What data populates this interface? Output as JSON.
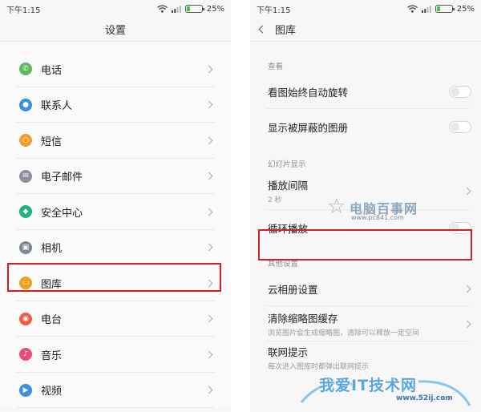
{
  "left": {
    "status": {
      "time": "下午1:15",
      "battery": "25%",
      "battery_level": 0.25
    },
    "title": "设置",
    "items": [
      {
        "label": "电话",
        "icon": "phone-icon",
        "color": "#5cb85c",
        "glyph": "✆"
      },
      {
        "label": "联系人",
        "icon": "contacts-icon",
        "color": "#3a8ee6",
        "glyph": "●"
      },
      {
        "label": "短信",
        "icon": "message-icon",
        "color": "#f39c27",
        "glyph": "○"
      },
      {
        "label": "电子邮件",
        "icon": "mail-icon",
        "color": "#8a9099",
        "glyph": "✉"
      },
      {
        "label": "安全中心",
        "icon": "shield-icon",
        "color": "#23b07a",
        "glyph": "◆"
      },
      {
        "label": "相机",
        "icon": "camera-icon",
        "color": "#7f8891",
        "glyph": "▣"
      },
      {
        "label": "图库",
        "icon": "gallery-icon",
        "color": "#f0a020",
        "glyph": "▭"
      },
      {
        "label": "电台",
        "icon": "radio-icon",
        "color": "#ec5b49",
        "glyph": "◉"
      },
      {
        "label": "音乐",
        "icon": "music-icon",
        "color": "#ec4b7a",
        "glyph": "♪"
      },
      {
        "label": "视频",
        "icon": "video-icon",
        "color": "#3a8ee6",
        "glyph": "▶"
      }
    ]
  },
  "right": {
    "status": {
      "time": "下午1:15",
      "battery": "25%",
      "battery_level": 0.25
    },
    "title": "图库",
    "sections": {
      "view": {
        "header": "查看",
        "auto_rotate": "看图始终自动旋转",
        "show_hidden": "显示被屏蔽的图册"
      },
      "slideshow": {
        "header": "幻灯片显示",
        "interval_label": "播放间隔",
        "interval_value": "2 秒",
        "loop_label": "循环播放"
      },
      "other": {
        "header": "其他设置",
        "cloud": "云相册设置",
        "clear_cache": "清除缩略图缓存",
        "clear_cache_sub": "浏览图片会生成缩略图，清除可以释放一定空间",
        "network": "联网提示",
        "network_sub": "每次进入图库时都弹出联网提示"
      }
    }
  },
  "watermarks": {
    "pc841_name": "电脑百事网",
    "pc841_url": "www.pc841.com",
    "52ij_name": "我爱IT技术网",
    "52ij_url": "www.52ij.com"
  },
  "accent": {
    "highlight": "#d62020"
  }
}
